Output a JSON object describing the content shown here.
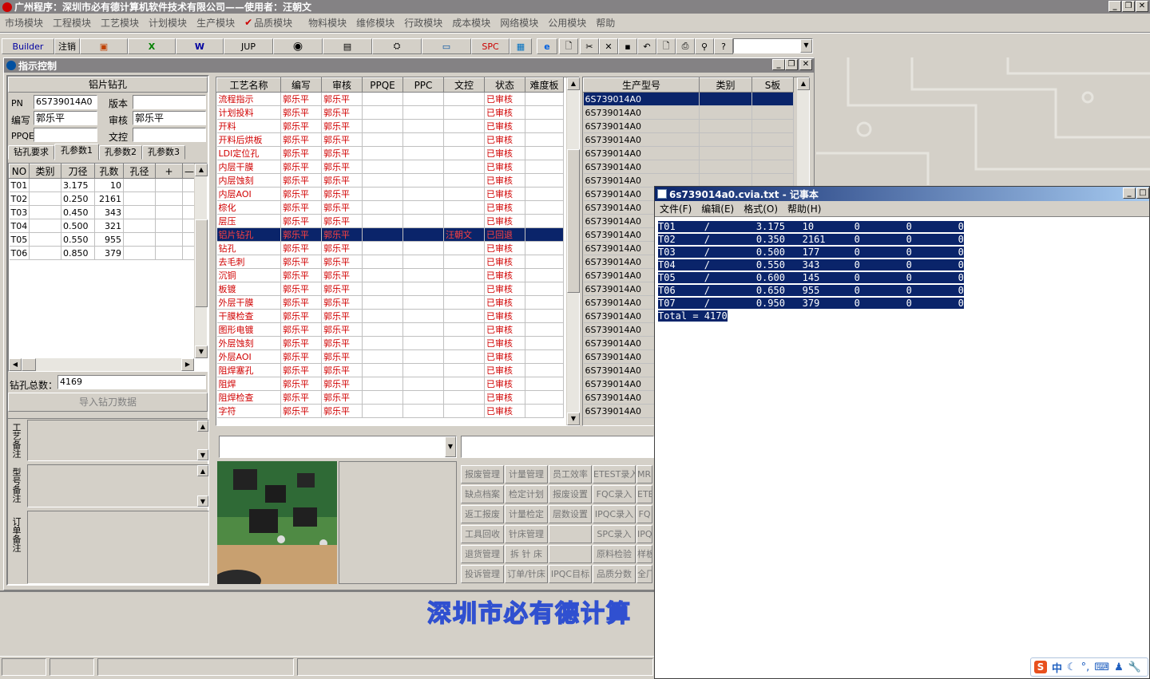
{
  "app": {
    "title": "广州程序：深圳市必有德计算机软件技术有限公司——使用者：汪朝文",
    "menu": [
      "市场模块",
      "工程模块",
      "工艺模块",
      "计划模块",
      "生产模块",
      "品质模块",
      "物料模块",
      "维修模块",
      "行政模块",
      "成本模块",
      "网络模块",
      "公用模块",
      "帮助"
    ],
    "toolbar": {
      "builder": "Builder",
      "logout": "注销",
      "jup": "JUP",
      "spc": "SPC"
    }
  },
  "window": {
    "title": "指示控制",
    "drill": {
      "header": "铝片钻孔",
      "pn_label": "PN",
      "pn": "6S739014A0",
      "version_label": "版本",
      "version": "",
      "code_label": "编写",
      "code": "郭乐平",
      "review_label": "审核",
      "review": "郭乐平",
      "ppqe_label": "PPQE",
      "ppqe": "",
      "wenkong_label": "文控",
      "wenkong": "",
      "tabs": [
        "钻孔要求",
        "孔参数1",
        "孔参数2",
        "孔参数3"
      ],
      "columns": [
        "NO",
        "类别",
        "刀径",
        "孔数",
        "孔径",
        "+",
        "—"
      ],
      "rows": [
        {
          "no": "T01 /",
          "type": "",
          "dia": "3.175",
          "count": "10"
        },
        {
          "no": "T02 /",
          "type": "",
          "dia": "0.250",
          "count": "2161"
        },
        {
          "no": "T03 /",
          "type": "",
          "dia": "0.450",
          "count": "343"
        },
        {
          "no": "T04 /",
          "type": "",
          "dia": "0.500",
          "count": "321"
        },
        {
          "no": "T05 /",
          "type": "",
          "dia": "0.550",
          "count": "955"
        },
        {
          "no": "T06 /",
          "type": "",
          "dia": "0.850",
          "count": "379"
        }
      ],
      "total_label": "钻孔总数：",
      "total": "4169",
      "import_button": "导入钻刀数据",
      "note1": "工艺备注",
      "note2": "型号备注",
      "note3": "订单备注"
    },
    "process": {
      "columns": [
        "工艺名称",
        "编写",
        "审核",
        "PPQE",
        "PPC",
        "文控",
        "状态",
        "难度板"
      ],
      "rows": [
        {
          "name": "流程指示",
          "a": "郭乐平",
          "b": "郭乐平",
          "wk": "",
          "st": "已审核"
        },
        {
          "name": "计划投料",
          "a": "郭乐平",
          "b": "郭乐平",
          "wk": "",
          "st": "已审核"
        },
        {
          "name": "开料",
          "a": "郭乐平",
          "b": "郭乐平",
          "wk": "",
          "st": "已审核"
        },
        {
          "name": "开料后烘板",
          "a": "郭乐平",
          "b": "郭乐平",
          "wk": "",
          "st": "已审核"
        },
        {
          "name": "LDI定位孔",
          "a": "郭乐平",
          "b": "郭乐平",
          "wk": "",
          "st": "已审核"
        },
        {
          "name": "内层干膜",
          "a": "郭乐平",
          "b": "郭乐平",
          "wk": "",
          "st": "已审核"
        },
        {
          "name": "内层蚀刻",
          "a": "郭乐平",
          "b": "郭乐平",
          "wk": "",
          "st": "已审核"
        },
        {
          "name": "内层AOI",
          "a": "郭乐平",
          "b": "郭乐平",
          "wk": "",
          "st": "已审核"
        },
        {
          "name": "棕化",
          "a": "郭乐平",
          "b": "郭乐平",
          "wk": "",
          "st": "已审核"
        },
        {
          "name": "层压",
          "a": "郭乐平",
          "b": "郭乐平",
          "wk": "",
          "st": "已审核"
        },
        {
          "name": "铝片钻孔",
          "a": "郭乐平",
          "b": "郭乐平",
          "wk": "汪朝文",
          "st": "已回退",
          "selected": true
        },
        {
          "name": "钻孔",
          "a": "郭乐平",
          "b": "郭乐平",
          "wk": "",
          "st": "已审核"
        },
        {
          "name": "去毛刺",
          "a": "郭乐平",
          "b": "郭乐平",
          "wk": "",
          "st": "已审核"
        },
        {
          "name": "沉铜",
          "a": "郭乐平",
          "b": "郭乐平",
          "wk": "",
          "st": "已审核"
        },
        {
          "name": "板镀",
          "a": "郭乐平",
          "b": "郭乐平",
          "wk": "",
          "st": "已审核"
        },
        {
          "name": "外层干膜",
          "a": "郭乐平",
          "b": "郭乐平",
          "wk": "",
          "st": "已审核"
        },
        {
          "name": "干膜检查",
          "a": "郭乐平",
          "b": "郭乐平",
          "wk": "",
          "st": "已审核"
        },
        {
          "name": "图形电镀",
          "a": "郭乐平",
          "b": "郭乐平",
          "wk": "",
          "st": "已审核"
        },
        {
          "name": "外层蚀刻",
          "a": "郭乐平",
          "b": "郭乐平",
          "wk": "",
          "st": "已审核"
        },
        {
          "name": "外层AOI",
          "a": "郭乐平",
          "b": "郭乐平",
          "wk": "",
          "st": "已审核"
        },
        {
          "name": "阻焊塞孔",
          "a": "郭乐平",
          "b": "郭乐平",
          "wk": "",
          "st": "已审核"
        },
        {
          "name": "阻焊",
          "a": "郭乐平",
          "b": "郭乐平",
          "wk": "",
          "st": "已审核"
        },
        {
          "name": "阻焊检查",
          "a": "郭乐平",
          "b": "郭乐平",
          "wk": "",
          "st": "已审核"
        },
        {
          "name": "字符",
          "a": "郭乐平",
          "b": "郭乐平",
          "wk": "",
          "st": "已审核"
        }
      ]
    },
    "models": {
      "columns": [
        "生产型号",
        "类别",
        "S板"
      ],
      "rows": [
        "6S739014A0",
        "6S739014A0",
        "6S739014A0",
        "6S739014A0",
        "6S739014A0",
        "6S739014A0",
        "6S739014A0",
        "6S739014A0",
        "6S739014A0",
        "6S739014A0",
        "6S739014A0",
        "6S739014A0",
        "6S739014A0",
        "6S739014A0",
        "6S739014A0",
        "6S739014A0",
        "6S739014A0",
        "6S739014A0",
        "6S739014A0",
        "6S739014A0",
        "6S739014A0",
        "6S739014A0",
        "6S739014A0",
        "6S739014A0"
      ]
    },
    "modules": [
      [
        "报废管理",
        "计量管理",
        "员工效率",
        "ETEST录入",
        "MRB"
      ],
      [
        "缺点档案",
        "检定计划",
        "报废设置",
        "FQC录入",
        "ETES"
      ],
      [
        "返工报废",
        "计量检定",
        "层数设置",
        "IPQC录入",
        "FQ"
      ],
      [
        "工具回收",
        "针床管理",
        "",
        "SPC录入",
        "IPQ"
      ],
      [
        "退货管理",
        "拆 针 床",
        "",
        "原料检验",
        "样板"
      ],
      [
        "投诉管理",
        "订单/针床",
        "IPQC目标",
        "品质分数",
        "全厂"
      ]
    ]
  },
  "banner": "深圳市必有德计算",
  "notepad": {
    "title": "6s739014a0.cvia.txt - 记事本",
    "menu": [
      "文件(F)",
      "编辑(E)",
      "格式(O)",
      "帮助(H)"
    ],
    "lines": [
      "T01     /        3.175   10       0        0        0",
      "T02     /        0.350   2161     0        0        0",
      "T03     /        0.500   177      0        0        0",
      "T04     /        0.550   343      0        0        0",
      "T05     /        0.600   145      0        0        0",
      "T06     /        0.650   955      0        0        0",
      "T07     /        0.950   379      0        0        0",
      "Total = 4170"
    ]
  },
  "ime": {
    "label": "中"
  }
}
